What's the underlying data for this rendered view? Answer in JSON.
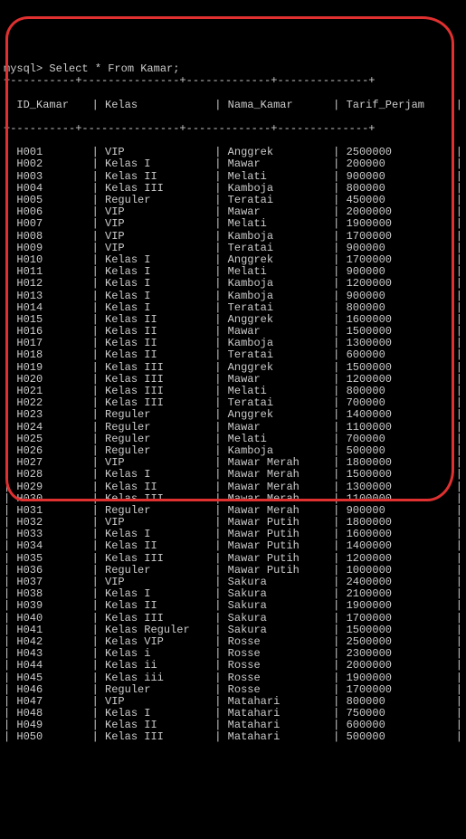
{
  "prompt": "mysql> Select * From Kamar;",
  "columns": [
    "ID_Kamar",
    "Kelas",
    "Nama_Kamar",
    "Tarif_Perjam"
  ],
  "divider_top": "+----------+---------------+-------------+--------------+",
  "divider_mid": "+----------+---------------+-------------+--------------+",
  "chart_data": {
    "type": "table",
    "columns": [
      "ID_Kamar",
      "Kelas",
      "Nama_Kamar",
      "Tarif_Perjam"
    ],
    "rows": [
      [
        "H001",
        "VIP",
        "Anggrek",
        "2500000"
      ],
      [
        "H002",
        "Kelas I",
        "Mawar",
        "200000"
      ],
      [
        "H003",
        "Kelas II",
        "Melati",
        "900000"
      ],
      [
        "H004",
        "Kelas III",
        "Kamboja",
        "800000"
      ],
      [
        "H005",
        "Reguler",
        "Teratai",
        "450000"
      ],
      [
        "H006",
        "VIP",
        "Mawar",
        "2000000"
      ],
      [
        "H007",
        "VIP",
        "Melati",
        "1900000"
      ],
      [
        "H008",
        "VIP",
        "Kamboja",
        "1700000"
      ],
      [
        "H009",
        "VIP",
        "Teratai",
        "900000"
      ],
      [
        "H010",
        "Kelas I",
        "Anggrek",
        "1700000"
      ],
      [
        "H011",
        "Kelas I",
        "Melati",
        "900000"
      ],
      [
        "H012",
        "Kelas I",
        "Kamboja",
        "1200000"
      ],
      [
        "H013",
        "Kelas I",
        "Kamboja",
        "900000"
      ],
      [
        "H014",
        "Kelas I",
        "Teratai",
        "800000"
      ],
      [
        "H015",
        "Kelas II",
        "Anggrek",
        "1600000"
      ],
      [
        "H016",
        "Kelas II",
        "Mawar",
        "1500000"
      ],
      [
        "H017",
        "Kelas II",
        "Kamboja",
        "1300000"
      ],
      [
        "H018",
        "Kelas II",
        "Teratai",
        "600000"
      ],
      [
        "H019",
        "Kelas III",
        "Anggrek",
        "1500000"
      ],
      [
        "H020",
        "Kelas III",
        "Mawar",
        "1200000"
      ],
      [
        "H021",
        "Kelas III",
        "Melati",
        "800000"
      ],
      [
        "H022",
        "Kelas III",
        "Teratai",
        "700000"
      ],
      [
        "H023",
        "Reguler",
        "Anggrek",
        "1400000"
      ],
      [
        "H024",
        "Reguler",
        "Mawar",
        "1100000"
      ],
      [
        "H025",
        "Reguler",
        "Melati",
        "700000"
      ],
      [
        "H026",
        "Reguler",
        "Kamboja",
        "500000"
      ],
      [
        "H027",
        "VIP",
        "Mawar Merah",
        "1800000"
      ],
      [
        "H028",
        "Kelas I",
        "Mawar Merah",
        "1500000"
      ],
      [
        "H029",
        "Kelas II",
        "Mawar Merah",
        "1300000"
      ],
      [
        "H030",
        "Kelas III",
        "Mawar Merah",
        "1100000"
      ],
      [
        "H031",
        "Reguler",
        "Mawar Merah",
        "900000"
      ],
      [
        "H032",
        "VIP",
        "Mawar Putih",
        "1800000"
      ],
      [
        "H033",
        "Kelas I",
        "Mawar Putih",
        "1600000"
      ],
      [
        "H034",
        "Kelas II",
        "Mawar Putih",
        "1400000"
      ],
      [
        "H035",
        "Kelas III",
        "Mawar Putih",
        "1200000"
      ],
      [
        "H036",
        "Reguler",
        "Mawar Putih",
        "1000000"
      ],
      [
        "H037",
        "VIP",
        "Sakura",
        "2400000"
      ],
      [
        "H038",
        "Kelas I",
        "Sakura",
        "2100000"
      ],
      [
        "H039",
        "Kelas II",
        "Sakura",
        "1900000"
      ],
      [
        "H040",
        "Kelas III",
        "Sakura",
        "1700000"
      ],
      [
        "H041",
        "Kelas Reguler",
        "Sakura",
        "1500000"
      ],
      [
        "H042",
        "Kelas VIP",
        "Rosse",
        "2500000"
      ],
      [
        "H043",
        "Kelas i",
        "Rosse",
        "2300000"
      ],
      [
        "H044",
        "Kelas ii",
        "Rosse",
        "2000000"
      ],
      [
        "H045",
        "Kelas iii",
        "Rosse",
        "1900000"
      ],
      [
        "H046",
        "Reguler",
        "Rosse",
        "1700000"
      ],
      [
        "H047",
        "VIP",
        "Matahari",
        "800000"
      ],
      [
        "H048",
        "Kelas I",
        "Matahari",
        "750000"
      ],
      [
        "H049",
        "Kelas II",
        "Matahari",
        "600000"
      ],
      [
        "H050",
        "Kelas III",
        "Matahari",
        "500000"
      ]
    ]
  }
}
